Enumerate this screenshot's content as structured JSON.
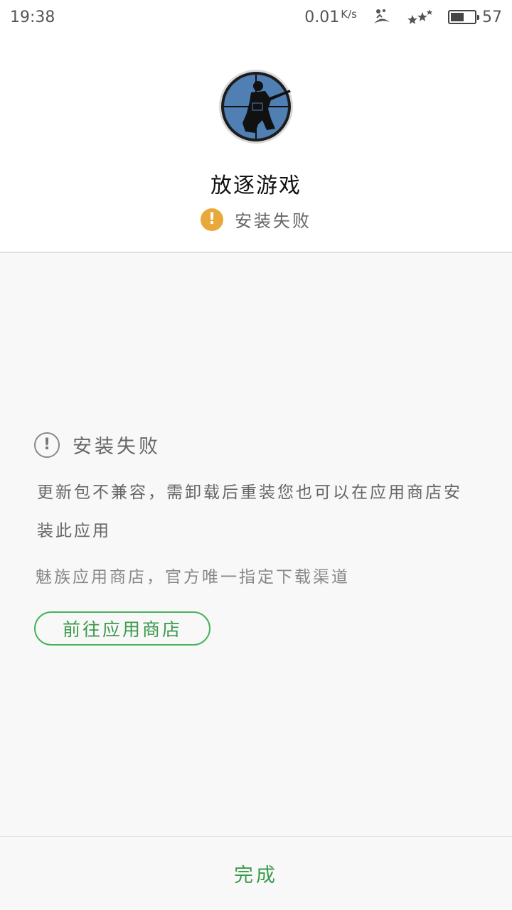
{
  "status_bar": {
    "time": "19:38",
    "net_speed": "0.01",
    "net_speed_unit": "K/s",
    "battery_level": "57",
    "battery_fraction": 0.57,
    "icons": [
      "signal-activity-icon",
      "notification-stars-icon",
      "battery-icon"
    ]
  },
  "app": {
    "name": "放逐游戏",
    "icon": "sniper-silhouette-app-icon",
    "install_status": "安装失败",
    "status_color": "#e8a93a"
  },
  "error": {
    "title": "安装失败",
    "description": "更新包不兼容，需卸载后重装您也可以在应用商店安装此应用",
    "note": "魅族应用商店，官方唯一指定下载渠道",
    "store_button": "前往应用商店",
    "accent_color": "#46b25a"
  },
  "footer": {
    "done_label": "完成"
  }
}
